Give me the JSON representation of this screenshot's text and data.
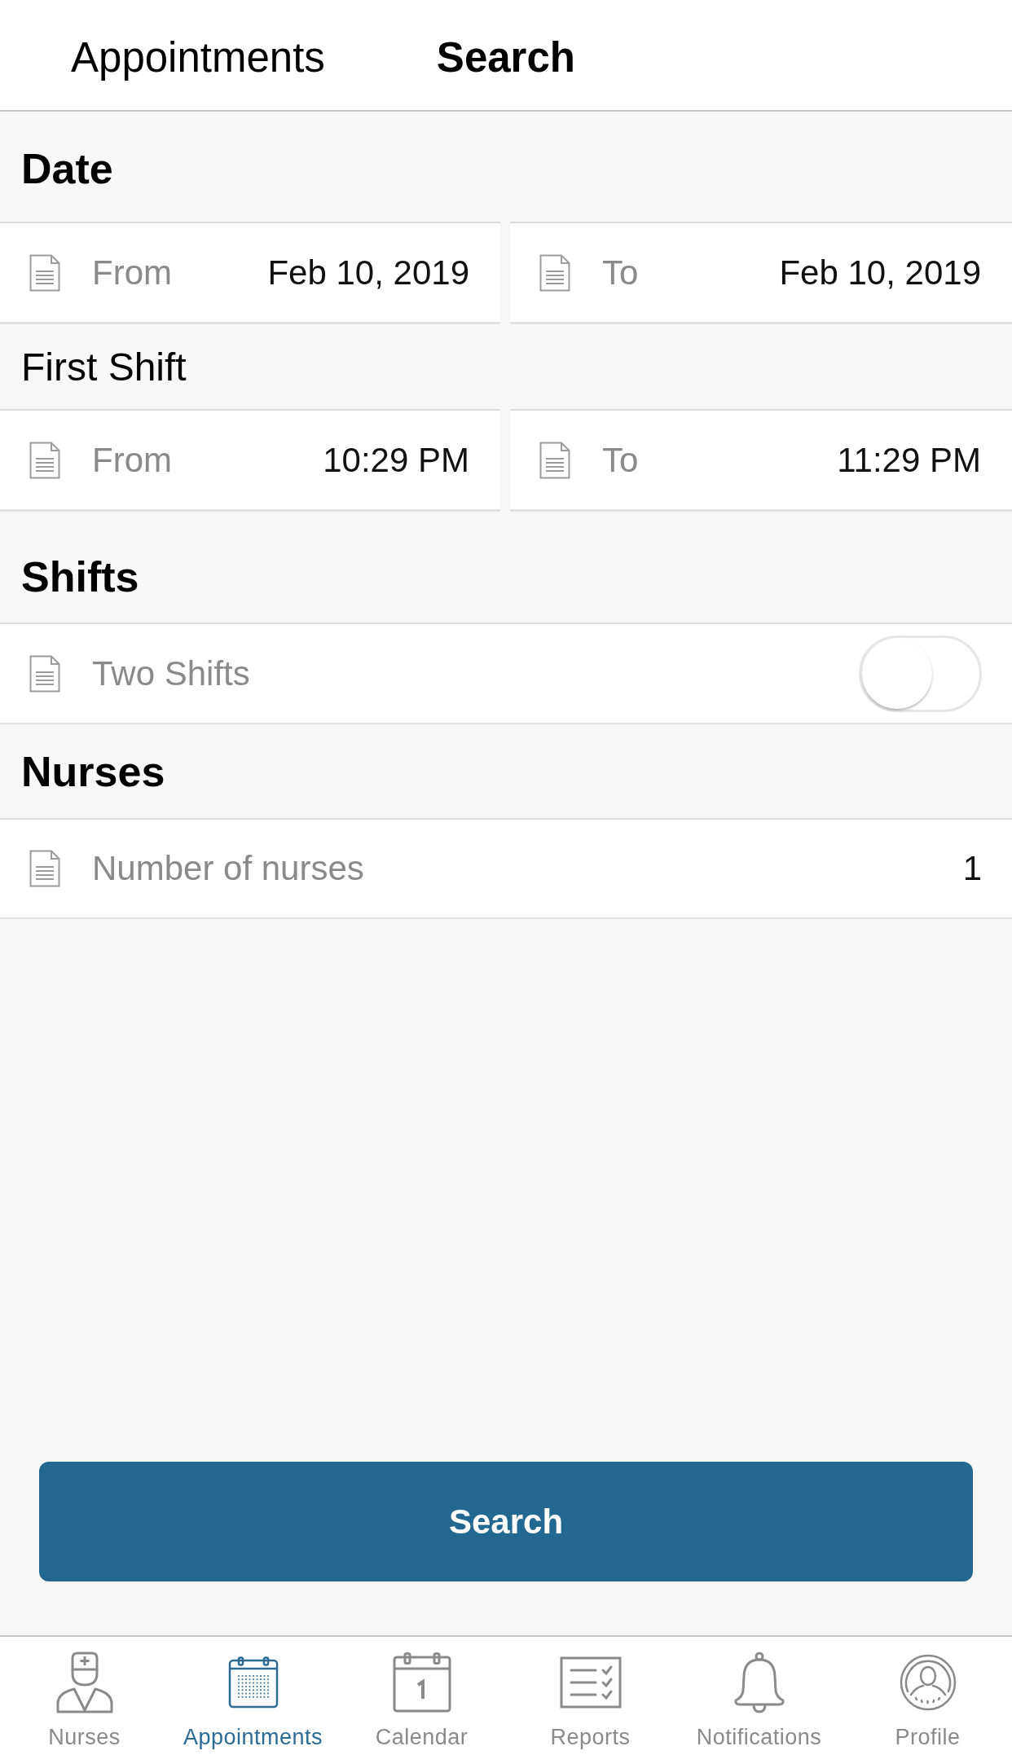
{
  "top_tabs": [
    {
      "label": "Appointments",
      "selected": false
    },
    {
      "label": "Search",
      "selected": true
    }
  ],
  "form": [
    {
      "kind": "header",
      "title": "Date"
    },
    {
      "kind": "range",
      "fields": [
        {
          "label": "From",
          "value": "Feb 10, 2019"
        },
        {
          "label": "To",
          "value": "Feb 10, 2019"
        }
      ]
    },
    {
      "kind": "subheader",
      "title": "First Shift"
    },
    {
      "kind": "range",
      "fields": [
        {
          "label": "From",
          "value": "10:29 PM"
        },
        {
          "label": "To",
          "value": "11:29 PM"
        }
      ]
    },
    {
      "kind": "header",
      "title": "Shifts"
    },
    {
      "kind": "toggle",
      "label": "Two Shifts",
      "on": false
    },
    {
      "kind": "header",
      "title": "Nurses"
    },
    {
      "kind": "value",
      "label": "Number of nurses",
      "value": "1"
    }
  ],
  "search_button": {
    "label": "Search"
  },
  "tab_bar": [
    {
      "label": "Nurses",
      "selected": false
    },
    {
      "label": "Appointments",
      "selected": true
    },
    {
      "label": "Calendar",
      "selected": false
    },
    {
      "label": "Reports",
      "selected": false
    },
    {
      "label": "Notifications",
      "selected": false
    },
    {
      "label": "Profile",
      "selected": false
    }
  ]
}
